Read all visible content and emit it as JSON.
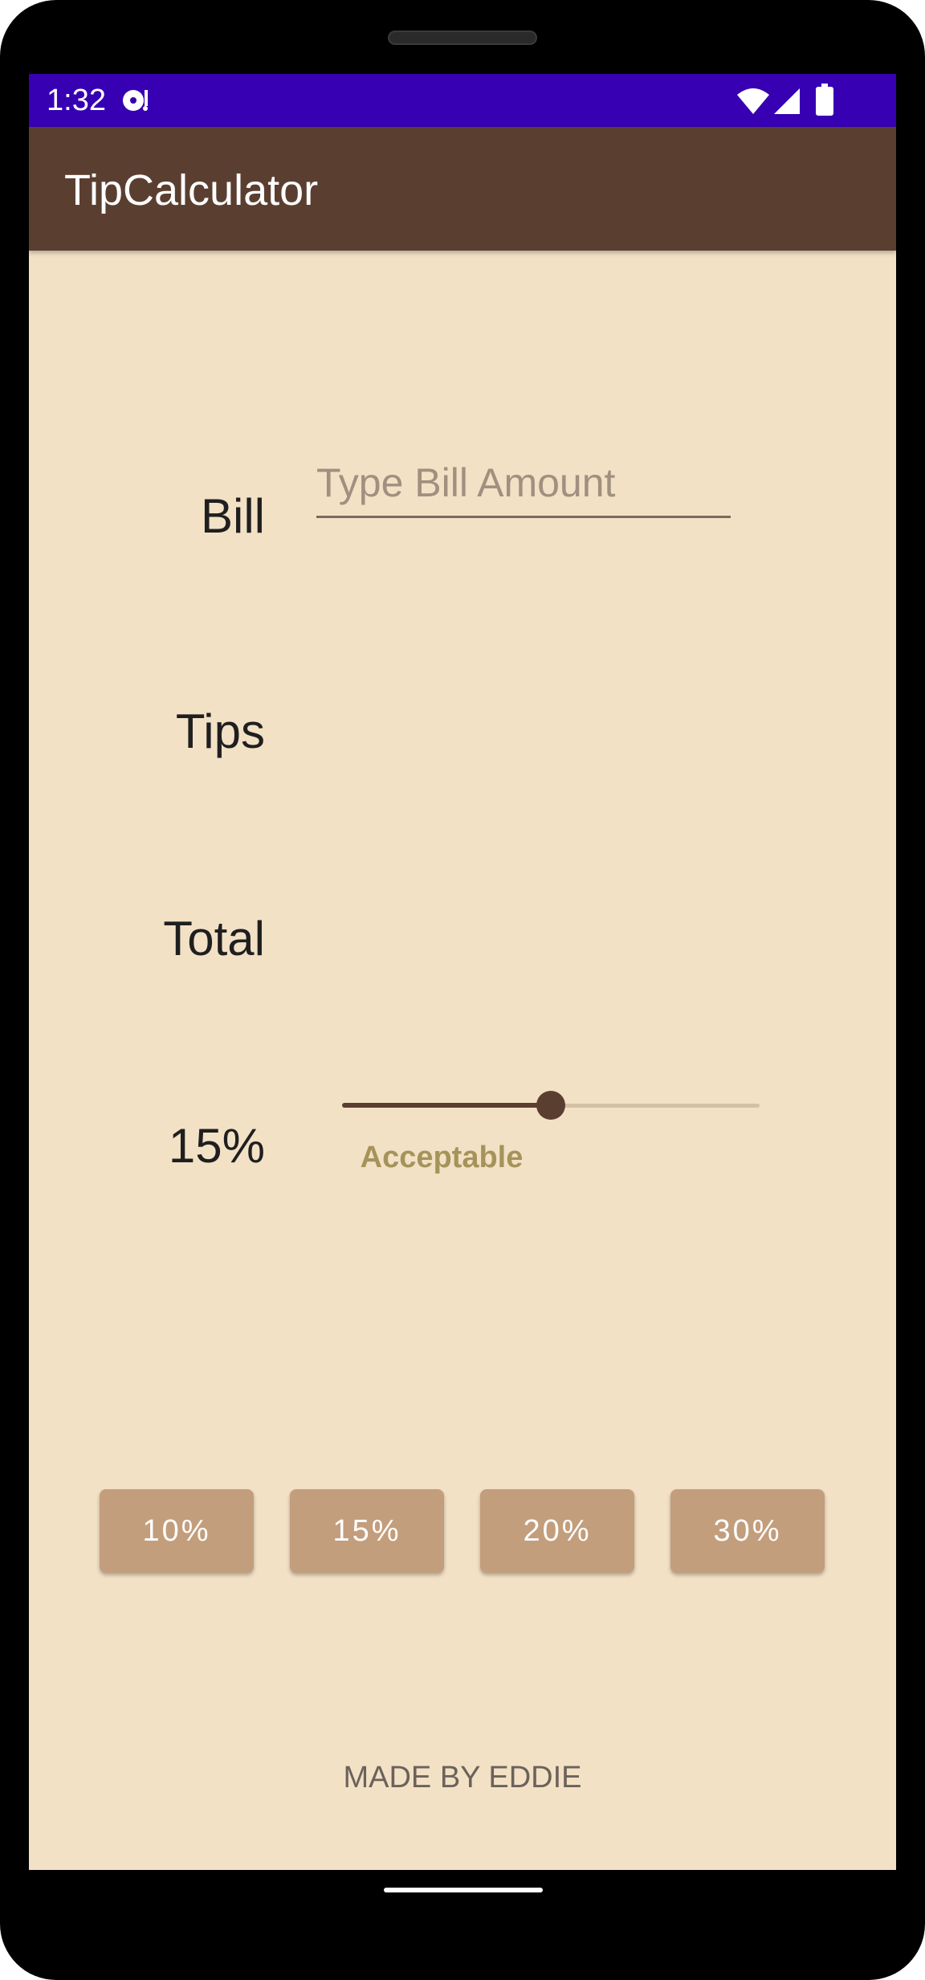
{
  "status_bar": {
    "time": "1:32",
    "icons": [
      "media-icon",
      "wifi-icon",
      "signal-icon",
      "battery-icon"
    ]
  },
  "app_bar": {
    "title": "TipCalculator"
  },
  "form": {
    "bill_label": "Bill",
    "bill_value": "",
    "bill_placeholder": "Type Bill Amount",
    "tips_label": "Tips",
    "tips_value": "",
    "total_label": "Total",
    "total_value": ""
  },
  "tip_slider": {
    "percent_label": "15%",
    "value": 15,
    "min": 0,
    "max": 30,
    "description": "Acceptable"
  },
  "preset_buttons": [
    {
      "label": "10%"
    },
    {
      "label": "15%"
    },
    {
      "label": "20%"
    },
    {
      "label": "30%"
    }
  ],
  "footer": {
    "text": "MADE BY EDDIE"
  },
  "colors": {
    "status_bar": "#3700B3",
    "app_bar": "#5A3F31",
    "background": "#F3E1C6",
    "button": "#C39E7C",
    "slider_active": "#5A3F31",
    "slider_inactive": "#D4C1A5",
    "description_text": "#A6935A"
  }
}
